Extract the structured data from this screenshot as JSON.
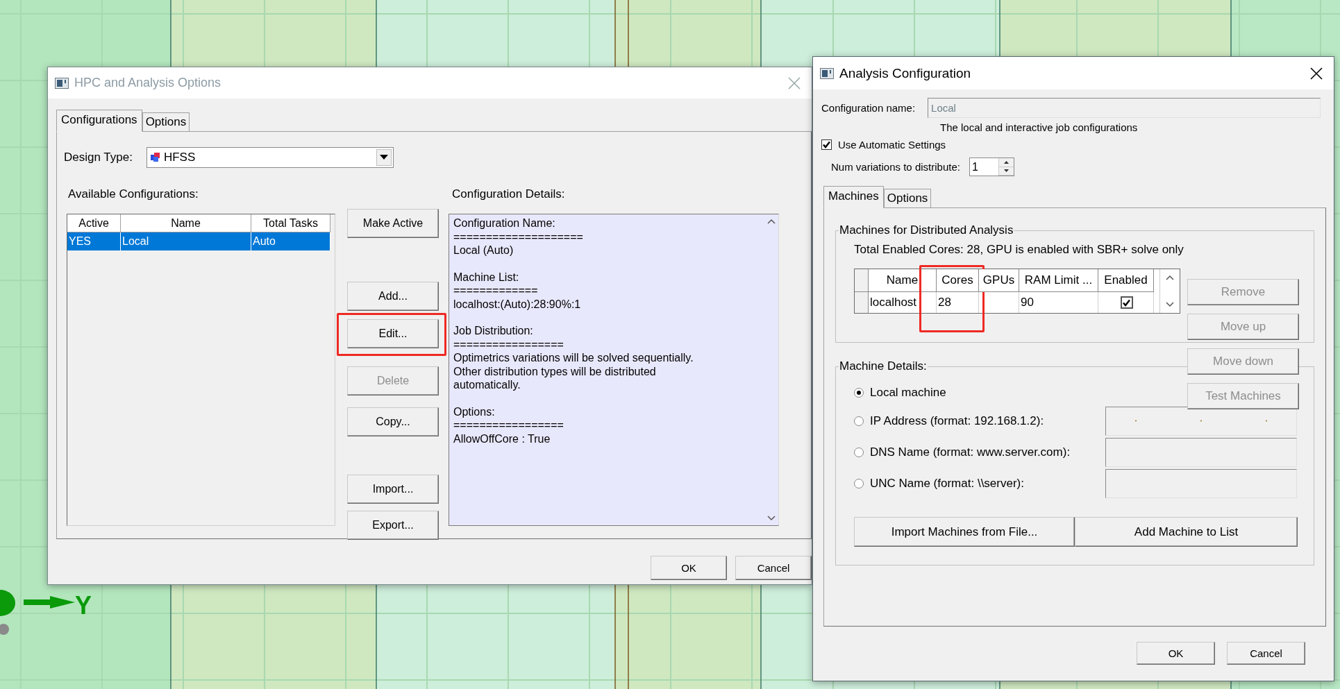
{
  "viewport": {
    "axis_label": "Y"
  },
  "hpc_dialog": {
    "title": "HPC and Analysis Options",
    "tabs": [
      {
        "label": "Configurations",
        "selected": true
      },
      {
        "label": "Options",
        "selected": false
      }
    ],
    "design_type": {
      "label": "Design Type:",
      "value": "HFSS"
    },
    "available_label": "Available Configurations:",
    "columns": [
      "Active",
      "Name",
      "Total Tasks"
    ],
    "rows": [
      {
        "cells": [
          "YES",
          "Local",
          "Auto"
        ],
        "selected": true
      }
    ],
    "buttons": [
      {
        "label": "Make Active",
        "disabled": false,
        "highlighted": false
      },
      {
        "label": "Add...",
        "disabled": false,
        "highlighted": false
      },
      {
        "label": "Edit...",
        "disabled": false,
        "highlighted": true
      },
      {
        "label": "Delete",
        "disabled": true,
        "highlighted": false
      },
      {
        "label": "Copy...",
        "disabled": false,
        "highlighted": false
      },
      {
        "label": "Import...",
        "disabled": false,
        "highlighted": false
      },
      {
        "label": "Export...",
        "disabled": false,
        "highlighted": false
      }
    ],
    "details_label": "Configuration Details:",
    "details": [
      {
        "lines": [
          "Configuration Name:",
          "====================",
          "Local (Auto)"
        ]
      },
      {
        "lines": [
          "Machine List:",
          "=============",
          "localhost:(Auto):28:90%:1"
        ]
      },
      {
        "lines": [
          "Job Distribution:",
          "=================",
          "Optimetrics variations will be solved sequentially.",
          "Other distribution types will be distributed",
          "automatically."
        ]
      },
      {
        "lines": [
          "Options:",
          "=================",
          "AllowOffCore : True"
        ]
      }
    ],
    "footer_buttons": [
      "OK",
      "Cancel"
    ]
  },
  "analysis_dialog": {
    "title": "Analysis Configuration",
    "config_name": {
      "label": "Configuration name:",
      "value": "Local"
    },
    "description": "The local and interactive job configurations",
    "use_automatic": {
      "label": "Use Automatic Settings",
      "checked": true
    },
    "num_variations": {
      "label": "Num variations to distribute:",
      "value": "1"
    },
    "tabs": [
      {
        "label": "Machines",
        "selected": true
      },
      {
        "label": "Options",
        "selected": false
      }
    ],
    "machines_group": {
      "title": "Machines for Distributed Analysis",
      "summary": "Total Enabled Cores: 28, GPU is enabled with SBR+ solve only",
      "columns": [
        {
          "label": "Name",
          "highlighted": false
        },
        {
          "label": "Cores",
          "highlighted": true
        },
        {
          "label": "GPUs",
          "highlighted": false
        },
        {
          "label": "RAM Limit ...",
          "highlighted": false
        },
        {
          "label": "Enabled",
          "highlighted": false
        }
      ],
      "rows": [
        {
          "name": "localhost",
          "cores": "28",
          "ram": "90",
          "enabled": true
        }
      ]
    },
    "side_buttons": [
      {
        "label": "Remove",
        "disabled": true
      },
      {
        "label": "Move up",
        "disabled": true
      },
      {
        "label": "Move down",
        "disabled": true
      },
      {
        "label": "Test Machines",
        "disabled": true
      }
    ],
    "details_group": {
      "title": "Machine Details:",
      "options": [
        {
          "label": "Local machine",
          "selected": true,
          "kind": "plain"
        },
        {
          "label": "IP Address (format: 192.168.1.2):",
          "selected": false,
          "kind": "ip"
        },
        {
          "label": "DNS Name (format: www.server.com):",
          "selected": false,
          "kind": "text"
        },
        {
          "label": "UNC Name (format: \\\\server):",
          "selected": false,
          "kind": "text"
        }
      ],
      "buttons": [
        "Import Machines from File...",
        "Add Machine to List"
      ]
    },
    "footer_buttons": [
      "OK",
      "Cancel"
    ]
  }
}
